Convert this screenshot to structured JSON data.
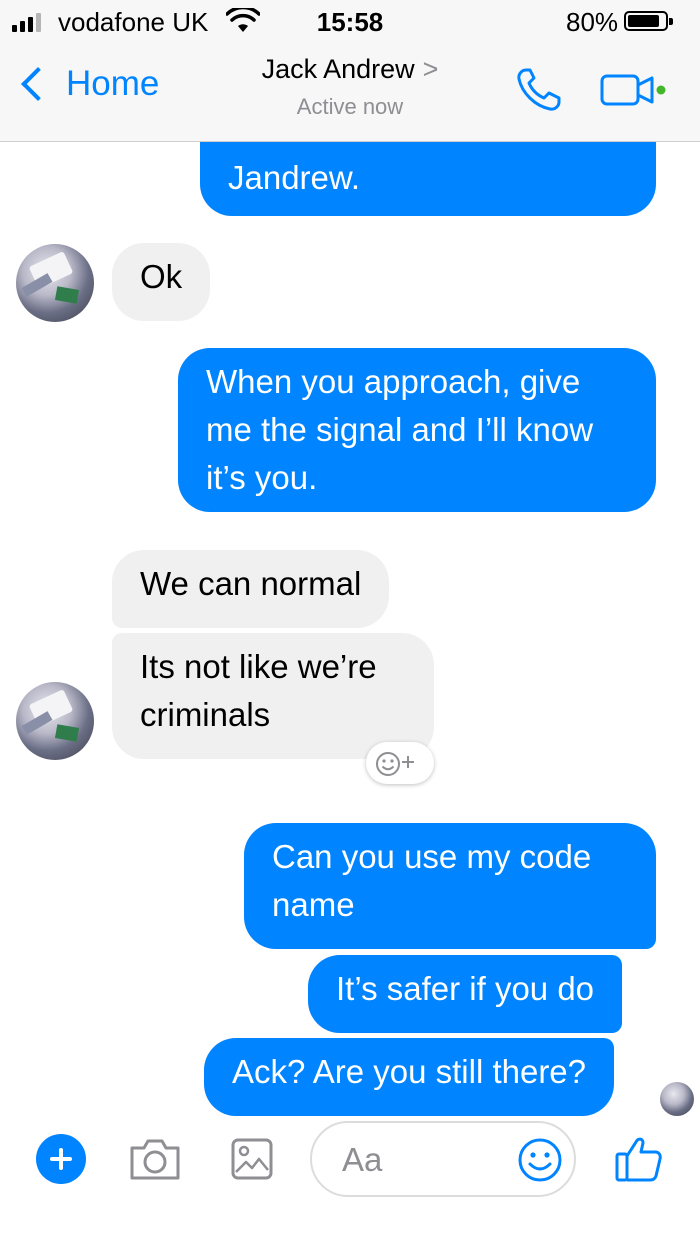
{
  "status_bar": {
    "carrier": "vodafone UK",
    "time": "15:58",
    "battery": "80%"
  },
  "nav": {
    "back_label": "Home",
    "contact_name": "Jack Andrew",
    "contact_chevron": ">",
    "contact_status": "Active now",
    "icons": [
      "phone-icon",
      "video-camera-icon"
    ]
  },
  "messages": [
    {
      "sender": "me",
      "text": "Jandrew."
    },
    {
      "sender": "them",
      "text": "Ok"
    },
    {
      "sender": "me",
      "text": "When you approach, give me the signal and I’ll know it’s you."
    },
    {
      "sender": "them",
      "text": "We can normal"
    },
    {
      "sender": "them",
      "text": "Its not like we’re criminals"
    },
    {
      "sender": "me",
      "text": "Can you use my code name"
    },
    {
      "sender": "me",
      "text": "It’s safer if you do"
    },
    {
      "sender": "me",
      "text": "Ack? Are you still there?"
    }
  ],
  "composer": {
    "placeholder": "Aa",
    "icons": [
      "plus-icon",
      "camera-icon",
      "gallery-icon",
      "emoji-icon",
      "thumbs-up-icon"
    ]
  },
  "colors": {
    "accent": "#0084ff",
    "incoming_bubble": "#f0f0f1",
    "secondary_text": "#8e8e93"
  }
}
